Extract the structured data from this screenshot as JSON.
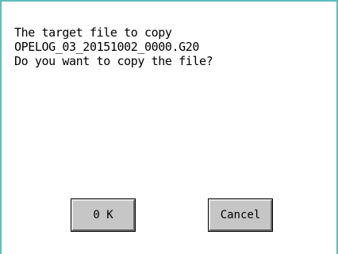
{
  "dialog": {
    "message_lines": [
      "The target file to copy",
      "OPELOG_03_20151002_0000.G20",
      "Do you want to copy the file?"
    ],
    "ok_label": "0 K",
    "cancel_label": "Cancel"
  },
  "colors": {
    "frame_border": "#5fbcbc",
    "button_face": "#c6c6c6"
  }
}
